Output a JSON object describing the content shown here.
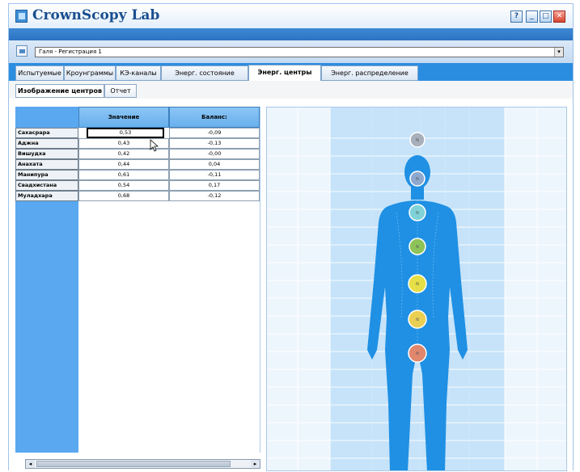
{
  "window": {
    "title": "CrownScopy Lab",
    "help_label": "?",
    "minimize_label": "_",
    "maximize_label": "□",
    "close_label": "✕"
  },
  "registration": {
    "selected": "Галя - Регистрация 1",
    "arrow": "▾"
  },
  "tabs": [
    {
      "label": "Испытуемые",
      "active": false
    },
    {
      "label": "Кроунграммы",
      "active": false
    },
    {
      "label": "КЭ-каналы",
      "active": false
    },
    {
      "label": "Энерг. состояние",
      "active": false
    },
    {
      "label": "Энерг. центры",
      "active": true
    },
    {
      "label": "Энерг. распределение",
      "active": false
    }
  ],
  "subtabs": [
    {
      "label": "Изображение центров",
      "active": true
    },
    {
      "label": "Отчет",
      "active": false
    }
  ],
  "table": {
    "columns": [
      "Значение",
      "Баланс:"
    ],
    "rows": [
      {
        "name": "Сахасрара",
        "value": "0,53",
        "balance": "-0,09",
        "selected": true
      },
      {
        "name": "Аджна",
        "value": "0,43",
        "balance": "-0,13"
      },
      {
        "name": "Вишудха",
        "value": "0,42",
        "balance": "-0,00"
      },
      {
        "name": "Анахата",
        "value": "0,44",
        "balance": "0,04"
      },
      {
        "name": "Манипура",
        "value": "0,61",
        "balance": "-0,11"
      },
      {
        "name": "Свадхистана",
        "value": "0,54",
        "balance": "0,17"
      },
      {
        "name": "Муладхара",
        "value": "0,68",
        "balance": "-0,12"
      }
    ]
  },
  "scrollbar": {
    "left_arrow": "◂",
    "right_arrow": "▸"
  },
  "body_figure": {
    "chakras": [
      {
        "name": "Сахасрара",
        "color": "#a8b0bc",
        "label": "N"
      },
      {
        "name": "Аджна",
        "color": "#8ea9d0",
        "label": "N"
      },
      {
        "name": "Вишудха",
        "color": "#7fd3d8",
        "label": "N"
      },
      {
        "name": "Анахата",
        "color": "#8ec35a",
        "label": "N"
      },
      {
        "name": "Манипура",
        "color": "#e6df45",
        "label": "N"
      },
      {
        "name": "Свадхистана",
        "color": "#e9cf52",
        "label": "N"
      },
      {
        "name": "Муладхара",
        "color": "#e0876d",
        "label": "N"
      }
    ]
  },
  "colors": {
    "frame_blue": "#2b8de0",
    "header_blue": "#5aa8ef",
    "body_blue": "#1d8ee3",
    "center_band": "#c6e3f9",
    "side_band": "#eaf4fd"
  }
}
